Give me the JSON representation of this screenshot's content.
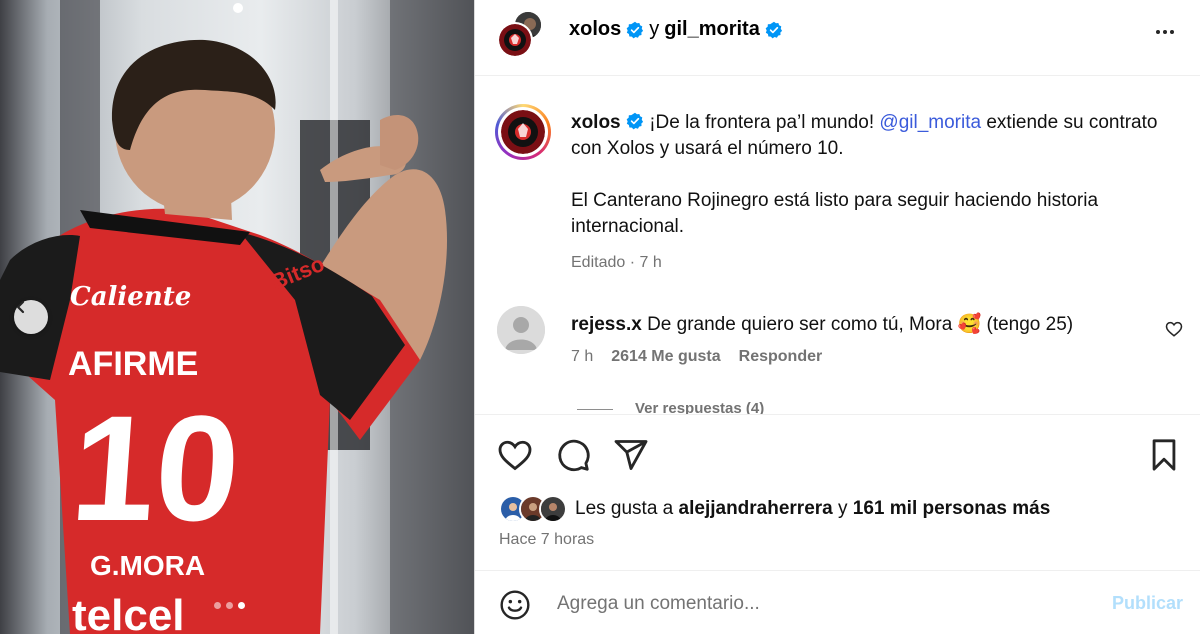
{
  "post": {
    "carousel": {
      "dot_count": 3,
      "active_index": 2
    },
    "header": {
      "account_1": "xolos",
      "connector": "y",
      "account_2": "gil_morita"
    },
    "caption": {
      "username": "xolos",
      "text_before_mention": "¡De la frontera pa’l mundo!",
      "mention": "@gil_morita",
      "text_after_mention": "extiende su contrato con Xolos y usará el número 10.",
      "second_paragraph": "El Canterano Rojinegro está listo para seguir haciendo historia internacional.",
      "edited_label": "Editado",
      "separator": "·",
      "time": "7 h"
    },
    "comment": {
      "username": "rejess.x",
      "text": "De grande quiero ser como tú, Mora 🥰 (tengo 25)",
      "time": "7 h",
      "likes": "2614 Me gusta",
      "reply_label": "Responder",
      "view_replies": "Ver respuestas (4)"
    },
    "likes": {
      "prefix": "Les gusta a",
      "user": "alejjandraherrera",
      "connector": "y",
      "others": "161 mil personas más"
    },
    "posted_time": "Hace 7 horas",
    "add_comment": {
      "placeholder": "Agrega un comentario...",
      "publish_label": "Publicar"
    }
  },
  "colors": {
    "mention": "#3b5bdb",
    "verified": "#0095f6",
    "publish_disabled": "#b2dffc",
    "jersey_red": "#d62a2a"
  },
  "icons": [
    "chevron-left-icon",
    "more-icon",
    "verified-icon",
    "heart-icon",
    "comment-icon",
    "share-icon",
    "bookmark-icon",
    "emoji-icon"
  ]
}
